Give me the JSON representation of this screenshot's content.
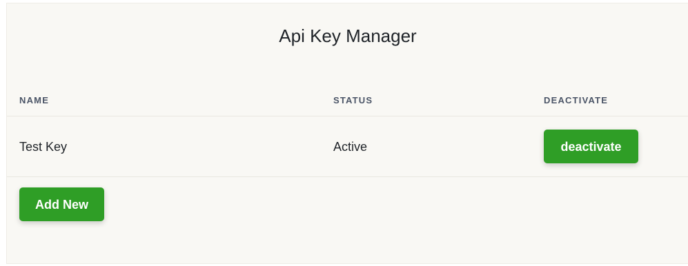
{
  "page": {
    "title": "Api Key Manager"
  },
  "table": {
    "columns": [
      "NAME",
      "STATUS",
      "DEACTIVATE"
    ],
    "rows": [
      {
        "name": "Test Key",
        "status": "Active",
        "action_label": "deactivate"
      }
    ]
  },
  "actions": {
    "add_new_label": "Add New"
  },
  "colors": {
    "accent": "#2f9e26",
    "panel_background": "#f9f8f4",
    "header_text": "#4a5466"
  }
}
